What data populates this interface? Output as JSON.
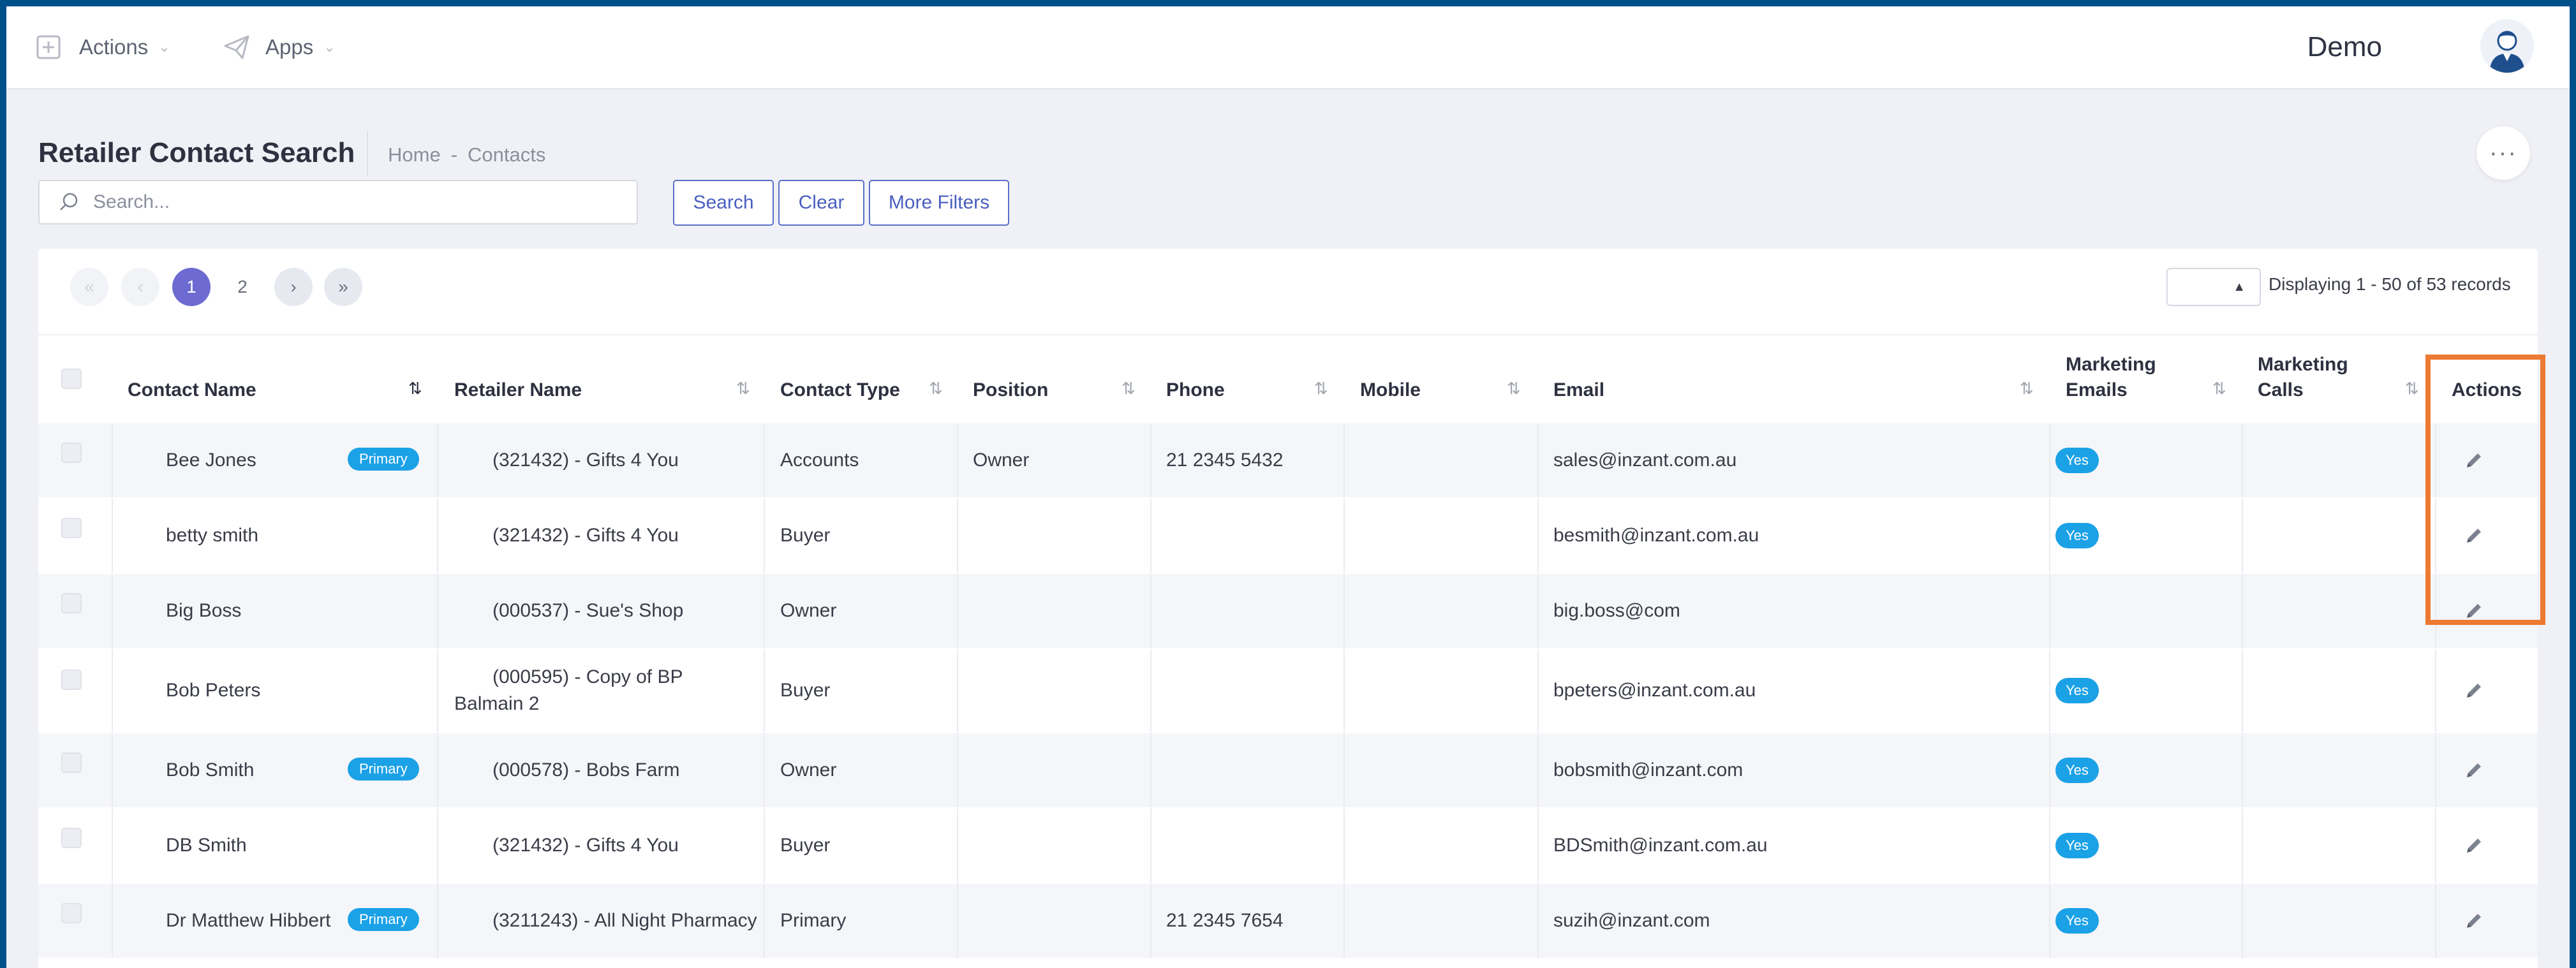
{
  "topbar": {
    "actions_label": "Actions",
    "apps_label": "Apps",
    "user_name": "Demo"
  },
  "page": {
    "title": "Retailer Contact Search",
    "breadcrumb": [
      "Home",
      "-",
      "Contacts"
    ]
  },
  "search": {
    "placeholder": "Search...",
    "value": "",
    "search_button": "Search",
    "clear_button": "Clear",
    "more_filters_button": "More Filters"
  },
  "pagination": {
    "pages": [
      "1",
      "2"
    ],
    "current_page": "1",
    "records_text": "Displaying 1 - 50 of 53 records",
    "page_size_selected": ""
  },
  "table": {
    "columns": {
      "contact_name": "Contact Name",
      "retailer_name": "Retailer Name",
      "contact_type": "Contact Type",
      "position": "Position",
      "phone": "Phone",
      "mobile": "Mobile",
      "email": "Email",
      "marketing_emails": [
        "Marketing",
        "Emails"
      ],
      "marketing_calls": [
        "Marketing",
        "Calls"
      ],
      "actions": "Actions"
    },
    "primary_label": "Primary",
    "yes_label": "Yes",
    "rows": [
      {
        "contact_name": "Bee Jones",
        "primary": true,
        "retailer": [
          "(321432) - Gifts 4 You"
        ],
        "contact_type": "Accounts",
        "position": "Owner",
        "phone": "21 2345 5432",
        "mobile": "",
        "email": "sales@inzant.com.au",
        "marketing_emails": "Yes",
        "marketing_calls": ""
      },
      {
        "contact_name": "betty smith",
        "primary": false,
        "retailer": [
          "(321432) - Gifts 4 You"
        ],
        "contact_type": "Buyer",
        "position": "",
        "phone": "",
        "mobile": "",
        "email": "besmith@inzant.com.au",
        "marketing_emails": "Yes",
        "marketing_calls": ""
      },
      {
        "contact_name": "Big Boss",
        "primary": false,
        "retailer": [
          "(000537) - Sue's Shop"
        ],
        "contact_type": "Owner",
        "position": "",
        "phone": "",
        "mobile": "",
        "email": "big.boss@com",
        "marketing_emails": "",
        "marketing_calls": ""
      },
      {
        "contact_name": "Bob Peters",
        "primary": false,
        "retailer": [
          "(000595) - Copy of BP",
          "Balmain 2"
        ],
        "contact_type": "Buyer",
        "position": "",
        "phone": "",
        "mobile": "",
        "email": "bpeters@inzant.com.au",
        "marketing_emails": "Yes",
        "marketing_calls": ""
      },
      {
        "contact_name": "Bob Smith",
        "primary": true,
        "retailer": [
          "(000578) - Bobs Farm"
        ],
        "contact_type": "Owner",
        "position": "",
        "phone": "",
        "mobile": "",
        "email": "bobsmith@inzant.com",
        "marketing_emails": "Yes",
        "marketing_calls": ""
      },
      {
        "contact_name": "DB Smith",
        "primary": false,
        "retailer": [
          "(321432) - Gifts 4 You"
        ],
        "contact_type": "Buyer",
        "position": "",
        "phone": "",
        "mobile": "",
        "email": "BDSmith@inzant.com.au",
        "marketing_emails": "Yes",
        "marketing_calls": ""
      },
      {
        "contact_name": "Dr Matthew Hibbert",
        "primary": true,
        "retailer": [
          "(3211243) - All Night Pharmacy"
        ],
        "contact_type": "Primary",
        "position": "",
        "phone": "21 2345 7654",
        "mobile": "",
        "email": "suzih@inzant.com",
        "marketing_emails": "Yes",
        "marketing_calls": ""
      }
    ]
  },
  "colors": {
    "accent": "#6d6bd1",
    "badge": "#1ba1e6",
    "highlight": "#ec7a32",
    "frame": "#00508a"
  },
  "icons": [
    "plus-square-icon",
    "paper-plane-icon",
    "chevron-down-icon",
    "user-avatar-icon",
    "more-horizontal-icon",
    "search-icon",
    "pagination-first-icon",
    "pagination-prev-icon",
    "pagination-next-icon",
    "pagination-last-icon",
    "sort-icon",
    "pencil-edit-icon"
  ]
}
